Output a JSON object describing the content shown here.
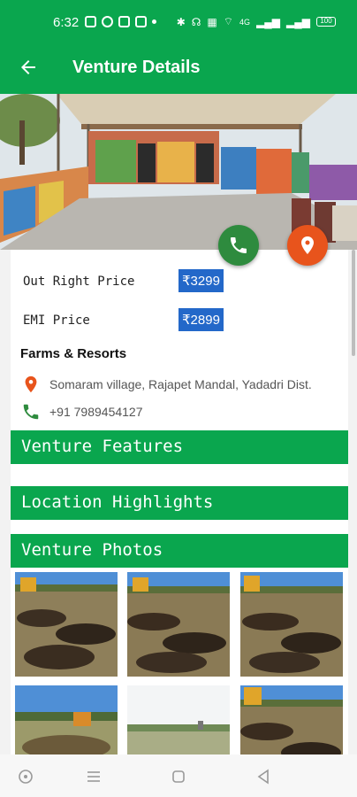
{
  "status": {
    "time": "6:32",
    "network_label": "4G",
    "battery": "100"
  },
  "app_bar": {
    "title": "Venture Details",
    "back_icon": "arrow-back-icon"
  },
  "prices": {
    "outright_label": "Out Right Price",
    "outright_value": "₹3299",
    "emi_label": "EMI Price",
    "emi_value": "₹2899"
  },
  "venture": {
    "category": "Farms & Resorts",
    "address": "Somaram village, Rajapet Mandal, Yadadri Dist.",
    "phone": "+91 7989454127"
  },
  "sections": {
    "features": "Venture Features",
    "location": "Location Highlights",
    "photos": "Venture Photos"
  },
  "colors": {
    "primary": "#0aa64e",
    "call_fab": "#2e8b3e",
    "location_fab": "#e8541c",
    "price_badge": "#2368c9",
    "location_icon": "#e8541c",
    "phone_icon": "#2e8b3e"
  },
  "nav": [
    "recent-apps-icon",
    "menu-icon",
    "home-icon",
    "back-triangle-icon"
  ]
}
